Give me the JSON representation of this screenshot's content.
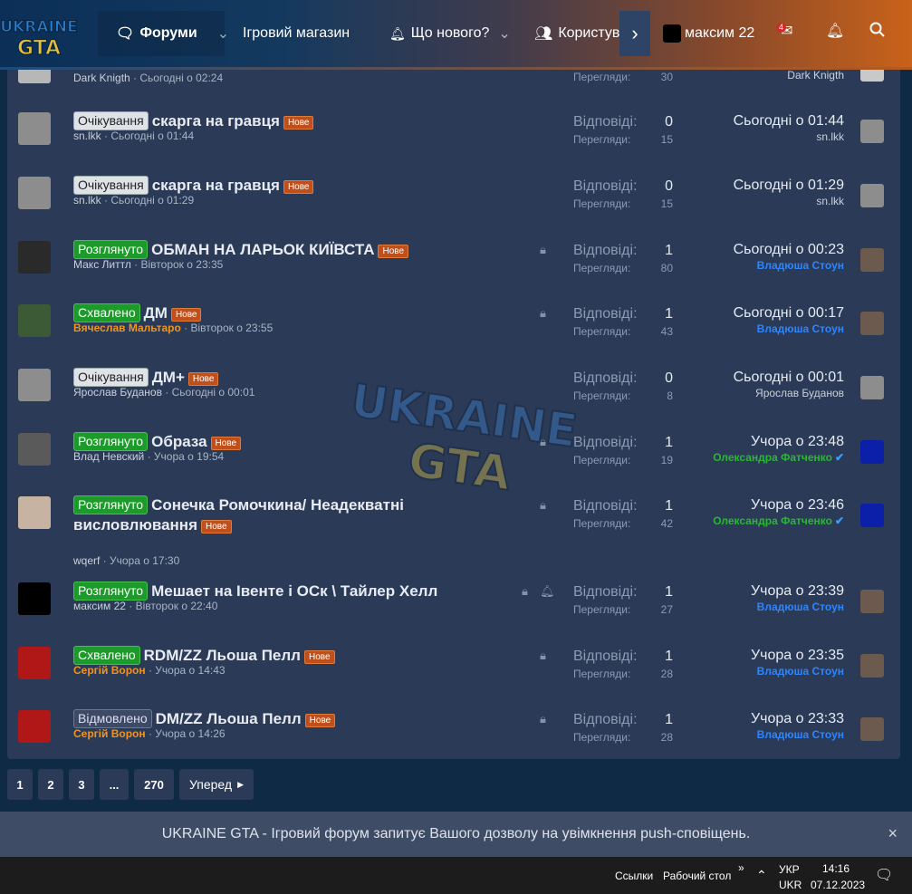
{
  "header": {
    "logo_text_top": "UKRAINE",
    "logo_text_bottom": "GTA",
    "nav": {
      "forums": "Форуми",
      "shop": "Ігровий магазин",
      "whats_new": "Що нового?",
      "users": "Користувачі",
      "username": "максим 22",
      "inbox_badge": "4"
    }
  },
  "labels": {
    "replies": "Відповіді:",
    "views": "Перегляди:",
    "new": "Нове"
  },
  "top_partial": {
    "meta_author": "Dark Knigth",
    "meta_date": " · Сьогодні о 02:24",
    "views": "30",
    "last_user": "Dark Knigth"
  },
  "threads": [
    {
      "prefix": "Очікування",
      "title": "скарга на гравця",
      "author": "sn.lkk",
      "date": " · Сьогодні о 01:44",
      "replies": "0",
      "views": "15",
      "last_date": "Сьогодні о 01:44",
      "last_user": "sn.lkk"
    },
    {
      "prefix": "Очікування",
      "title": "скарга на гравця",
      "author": "sn.lkk",
      "date": " · Сьогодні о 01:29",
      "replies": "0",
      "views": "15",
      "last_date": "Сьогодні о 01:29",
      "last_user": "sn.lkk"
    },
    {
      "prefix": "Розглянуто",
      "title": "ОБМАН НА ЛАРЬОК КИЇВСТА",
      "author": "Макс Литтл",
      "date": " · Вівторок о 23:35",
      "replies": "1",
      "views": "80",
      "last_date": "Сьогодні о 00:23",
      "last_user": "Владюша Стоун"
    },
    {
      "prefix": "Схвалено",
      "title": "ДМ",
      "author": "Вячеслав Мальтаро",
      "date": " · Вівторок о 23:55",
      "replies": "1",
      "views": "43",
      "last_date": "Сьогодні о 00:17",
      "last_user": "Владюша Стоун"
    },
    {
      "prefix": "Очікування",
      "title": "ДМ+",
      "author": "Ярослав Буданов",
      "date": " · Сьогодні о 00:01",
      "replies": "0",
      "views": "8",
      "last_date": "Сьогодні о 00:01",
      "last_user": "Ярослав Буданов"
    },
    {
      "prefix": "Розглянуто",
      "title": "Образа",
      "author": "Влад Невский",
      "date": " · Учора о 19:54",
      "replies": "1",
      "views": "19",
      "last_date": "Учора о 23:48",
      "last_user": "Олександра Фатченко"
    },
    {
      "prefix": "Розглянуто",
      "title": "Сонечка Ромочкина/ Неадекватні",
      "title2": "висловлювання",
      "author": "wqerf",
      "date": " · Учора о 17:30",
      "replies": "1",
      "views": "42",
      "last_date": "Учора о 23:46",
      "last_user": "Олександра Фатченко"
    },
    {
      "prefix": "Розглянуто",
      "title": "Мешает на Івенте і ОСк \\ Тайлер Хелл",
      "author": "максим 22",
      "date": " · Вівторок о 22:40",
      "replies": "1",
      "views": "27",
      "last_date": "Учора о 23:39",
      "last_user": "Владюша Стоун"
    },
    {
      "prefix": "Схвалено",
      "title": "RDM/ZZ Льоша Пелл",
      "author": "Сергій Ворон",
      "date": " · Учора о 14:43",
      "replies": "1",
      "views": "28",
      "last_date": "Учора о 23:35",
      "last_user": "Владюша Стоун"
    },
    {
      "prefix": "Відмовлено",
      "title": "DM/ZZ Льоша Пелл",
      "author": "Сергій Ворон",
      "date": " · Учора о 14:26",
      "replies": "1",
      "views": "28",
      "last_date": "Учора о 23:33",
      "last_user": "Владюша Стоун"
    }
  ],
  "pagination": {
    "pages": [
      "1",
      "2",
      "3",
      "...",
      "270"
    ],
    "next": "Уперед"
  },
  "push_notice": {
    "text": "UKRAINE GTA - Ігровий форум запитує Вашого дозволу на увімкнення push-сповіщень.",
    "close": "×"
  },
  "taskbar": {
    "links": "Ссылки",
    "desktop": "Рабочий стол",
    "lang1": "УКР",
    "lang2": "UKR",
    "time": "14:16",
    "date": "07.12.2023"
  },
  "colors": {
    "accent_orange": "#c9621a",
    "header_blue": "#0b2f57",
    "approved_green": "#1c9a2a",
    "username_blue": "#2e86ff",
    "username_green": "#29b832",
    "username_orange": "#f0941e"
  }
}
